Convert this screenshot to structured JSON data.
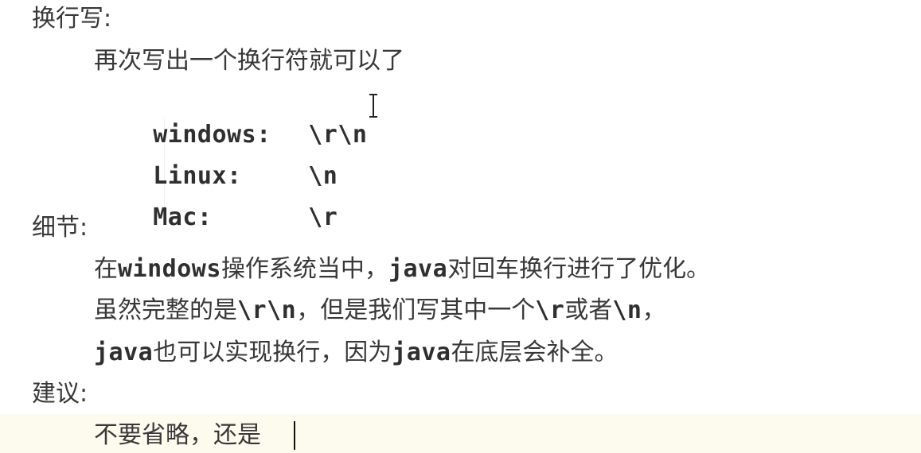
{
  "section_newline": {
    "heading": "换行写:",
    "description": "再次写出一个换行符就可以了",
    "os_list": [
      {
        "label": "windows:",
        "value": "\\r\\n"
      },
      {
        "label": "Linux:",
        "value": "\\n"
      },
      {
        "label": "Mac:",
        "value": "\\r"
      }
    ]
  },
  "section_details": {
    "heading": "细节:",
    "line1": {
      "p1": "在",
      "c1": "windows",
      "p2": "操作系统当中，",
      "c2": "java",
      "p3": "对回车换行进行了优化。"
    },
    "line2": {
      "p1": "虽然完整的是",
      "c1": "\\r\\n",
      "p2": "，但是我们写其中一个",
      "c2": "\\r",
      "p3": "或者",
      "c3": "\\n",
      "p4": "，"
    },
    "line3": {
      "c1": "java",
      "p1": "也可以实现换行，因为",
      "c2": "java",
      "p2": "在底层会补全。"
    }
  },
  "section_suggestion": {
    "heading": "建议:",
    "text": "不要省略，还是"
  },
  "colors": {
    "text": "#383838",
    "current_line_highlight": "#fdfaee",
    "caret": "#111111"
  },
  "icons": {
    "mouse_cursor": "ibeam-cursor-icon"
  }
}
